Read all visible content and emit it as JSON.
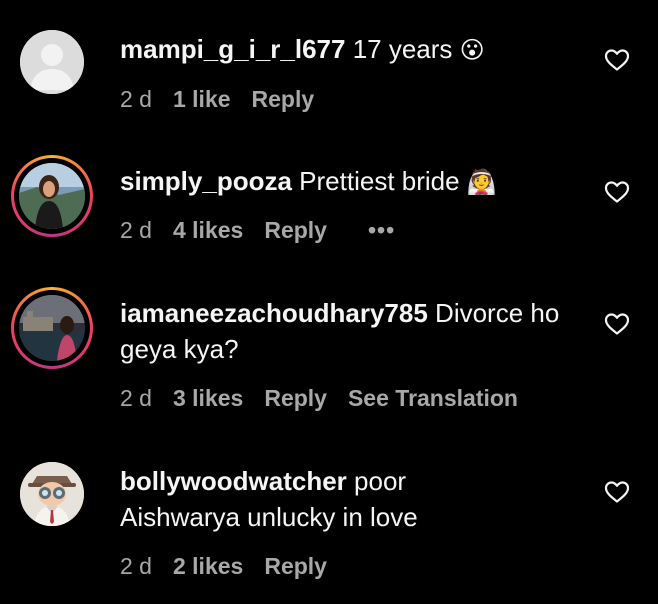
{
  "comments": [
    {
      "username": "mampi_g_i_r_l677",
      "text": "17 years",
      "emoji": "😮",
      "time": "2 d",
      "likes": "1 like",
      "reply": "Reply",
      "avatar": "default-avatar"
    },
    {
      "username": "simply_pooza",
      "text": "Prettiest bride",
      "emoji": "👰",
      "time": "2 d",
      "likes": "4 likes",
      "reply": "Reply",
      "more": "•••",
      "avatar": "story-ring-avatar"
    },
    {
      "username": "iamaneezachoudhary785",
      "text": "Divorce ho geya kya?",
      "time": "2 d",
      "likes": "3 likes",
      "reply": "Reply",
      "see_translation": "See Translation",
      "avatar": "story-ring-avatar"
    },
    {
      "username": "bollywoodwatcher",
      "text": "poor Aishwarya unlucky in love",
      "time": "2 d",
      "likes": "2 likes",
      "reply": "Reply",
      "avatar": "watcher-avatar"
    }
  ],
  "icons": {
    "like": "heart-icon",
    "default_avatar": "user-silhouette-icon"
  },
  "colors": {
    "background": "#000000",
    "text": "#f5f5f5",
    "meta": "#a8a8a8"
  }
}
